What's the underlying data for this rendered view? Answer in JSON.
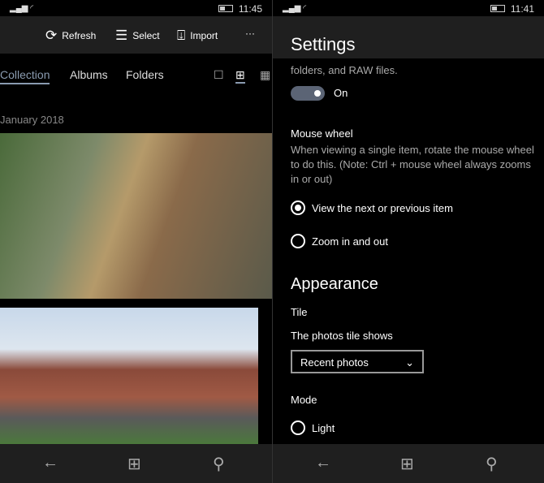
{
  "left": {
    "status": {
      "time": "11:45"
    },
    "toolbar": {
      "refresh": "Refresh",
      "select": "Select",
      "import": "Import",
      "more": "···"
    },
    "tabs": [
      "Collection",
      "Albums",
      "Folders"
    ],
    "view_icons": [
      "single-view-icon",
      "medium-grid-icon",
      "small-grid-icon"
    ],
    "section_date": "January 2018"
  },
  "right": {
    "status": {
      "time": "11:41"
    },
    "title": "Settings",
    "cut_text": "folders, and RAW files.",
    "toggle": {
      "state": "On",
      "value": true
    },
    "mouse_wheel": {
      "heading": "Mouse wheel",
      "description": "When viewing a single item, rotate the mouse wheel to do this. (Note: Ctrl + mouse wheel always zooms in or out)",
      "options": [
        "View the next or previous item",
        "Zoom in and out"
      ],
      "selected": 0
    },
    "appearance": {
      "heading": "Appearance",
      "tile_heading": "Tile",
      "tile_label": "The photos tile shows",
      "tile_value": "Recent photos",
      "mode_heading": "Mode",
      "mode_options": [
        "Light"
      ]
    }
  },
  "colors": {
    "accent": "#8a9bb0",
    "bar": "#1f1f1f",
    "toggle": "#5b6475"
  }
}
